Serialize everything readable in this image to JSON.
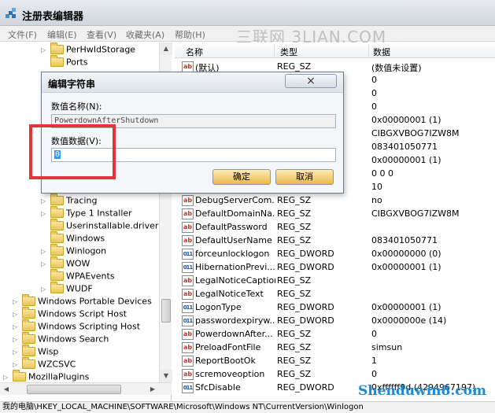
{
  "window": {
    "title": "注册表编辑器"
  },
  "menu": [
    "文件(F)",
    "编辑(E)",
    "查看(V)",
    "收藏夹(A)",
    "帮助(H)"
  ],
  "watermark": "三联网 3LIAN.COM",
  "tree": [
    {
      "label": "PerHwIdStorage",
      "indent": 1,
      "expander": "▷"
    },
    {
      "label": "Ports",
      "indent": 1,
      "expander": ""
    },
    {
      "label": "Tracing",
      "indent": 1,
      "expander": "▷"
    },
    {
      "label": "Type 1 Installer",
      "indent": 1,
      "expander": "▷"
    },
    {
      "label": "Userinstallable.drivers",
      "indent": 1,
      "expander": ""
    },
    {
      "label": "Windows",
      "indent": 1,
      "expander": ""
    },
    {
      "label": "Winlogon",
      "indent": 1,
      "expander": "▷"
    },
    {
      "label": "WOW",
      "indent": 1,
      "expander": "▷"
    },
    {
      "label": "WPAEvents",
      "indent": 1,
      "expander": ""
    },
    {
      "label": "WUDF",
      "indent": 1,
      "expander": "▷"
    },
    {
      "label": "Windows Portable Devices",
      "indent": 0,
      "expander": "▷"
    },
    {
      "label": "Windows Script Host",
      "indent": 0,
      "expander": "▷"
    },
    {
      "label": "Windows Scripting Host",
      "indent": 0,
      "expander": "▷"
    },
    {
      "label": "Windows Search",
      "indent": 0,
      "expander": "▷"
    },
    {
      "label": "Wisp",
      "indent": 0,
      "expander": "▷"
    },
    {
      "label": "WZCSVC",
      "indent": 0,
      "expander": "▷"
    },
    {
      "label": "MozillaPlugins",
      "indent": -1,
      "expander": "▷"
    }
  ],
  "columns": {
    "name": "名称",
    "type": "类型",
    "data": "数据"
  },
  "rows_top": [
    {
      "icon": "sz",
      "name": "(默认)",
      "type": "REG_SZ",
      "data": "(数值未设置)"
    },
    {
      "icon": "",
      "name": "",
      "type": "",
      "data": "0"
    },
    {
      "icon": "",
      "name": "",
      "type": "",
      "data": "0"
    },
    {
      "icon": "",
      "name": "",
      "type": "",
      "data": "0"
    },
    {
      "icon": "",
      "name": "",
      "type": "",
      "data": "0x00000001 (1)"
    },
    {
      "icon": "",
      "name": "",
      "type": "",
      "data": "CIBGXVBOG7IZW8M"
    },
    {
      "icon": "",
      "name": "",
      "type": "",
      "data": "083401050771"
    },
    {
      "icon": "",
      "name": "",
      "type": "",
      "data": "0x00000001 (1)"
    },
    {
      "icon": "",
      "name": "",
      "type": "",
      "data": "0 0 0"
    },
    {
      "icon": "",
      "name": "",
      "type": "",
      "data": "10"
    }
  ],
  "rows": [
    {
      "icon": "sz",
      "name": "DebugServerCom...",
      "type": "REG_SZ",
      "data": "no"
    },
    {
      "icon": "sz",
      "name": "DefaultDomainNa...",
      "type": "REG_SZ",
      "data": "CIBGXVBOG7IZW8M"
    },
    {
      "icon": "sz",
      "name": "DefaultPassword",
      "type": "REG_SZ",
      "data": ""
    },
    {
      "icon": "sz",
      "name": "DefaultUserName",
      "type": "REG_SZ",
      "data": "083401050771"
    },
    {
      "icon": "dw",
      "name": "forceunlocklogon",
      "type": "REG_DWORD",
      "data": "0x00000000 (0)"
    },
    {
      "icon": "dw",
      "name": "HibernationPrevi...",
      "type": "REG_DWORD",
      "data": "0x00000001 (1)"
    },
    {
      "icon": "sz",
      "name": "LegalNoticeCaption",
      "type": "REG_SZ",
      "data": ""
    },
    {
      "icon": "sz",
      "name": "LegalNoticeText",
      "type": "REG_SZ",
      "data": ""
    },
    {
      "icon": "dw",
      "name": "LogonType",
      "type": "REG_DWORD",
      "data": "0x00000001 (1)"
    },
    {
      "icon": "dw",
      "name": "passwordexpiryw...",
      "type": "REG_DWORD",
      "data": "0x0000000e (14)"
    },
    {
      "icon": "sz",
      "name": "PowerdownAfter...",
      "type": "REG_SZ",
      "data": "0"
    },
    {
      "icon": "sz",
      "name": "PreloadFontFile",
      "type": "REG_SZ",
      "data": "simsun"
    },
    {
      "icon": "sz",
      "name": "ReportBootOk",
      "type": "REG_SZ",
      "data": "1"
    },
    {
      "icon": "sz",
      "name": "scremoveoption",
      "type": "REG_SZ",
      "data": "0"
    },
    {
      "icon": "dw",
      "name": "SfcDisable",
      "type": "REG_DWORD",
      "data": "0xffffff9d (4294967197)"
    }
  ],
  "status": "我的电脑\\HKEY_LOCAL_MACHINE\\SOFTWARE\\Microsoft\\Windows NT\\CurrentVersion\\Winlogon",
  "logo": "Shenduwin8.com",
  "dialog": {
    "title": "编辑字符串",
    "close": "×",
    "name_label": "数值名称(N):",
    "name_value": "PowerdownAfterShutdown",
    "data_label": "数值数据(V):",
    "data_value": "0",
    "ok": "确定",
    "cancel": "取消"
  },
  "colors": {
    "highlight": "#e5333b",
    "selection": "#3399ff"
  }
}
